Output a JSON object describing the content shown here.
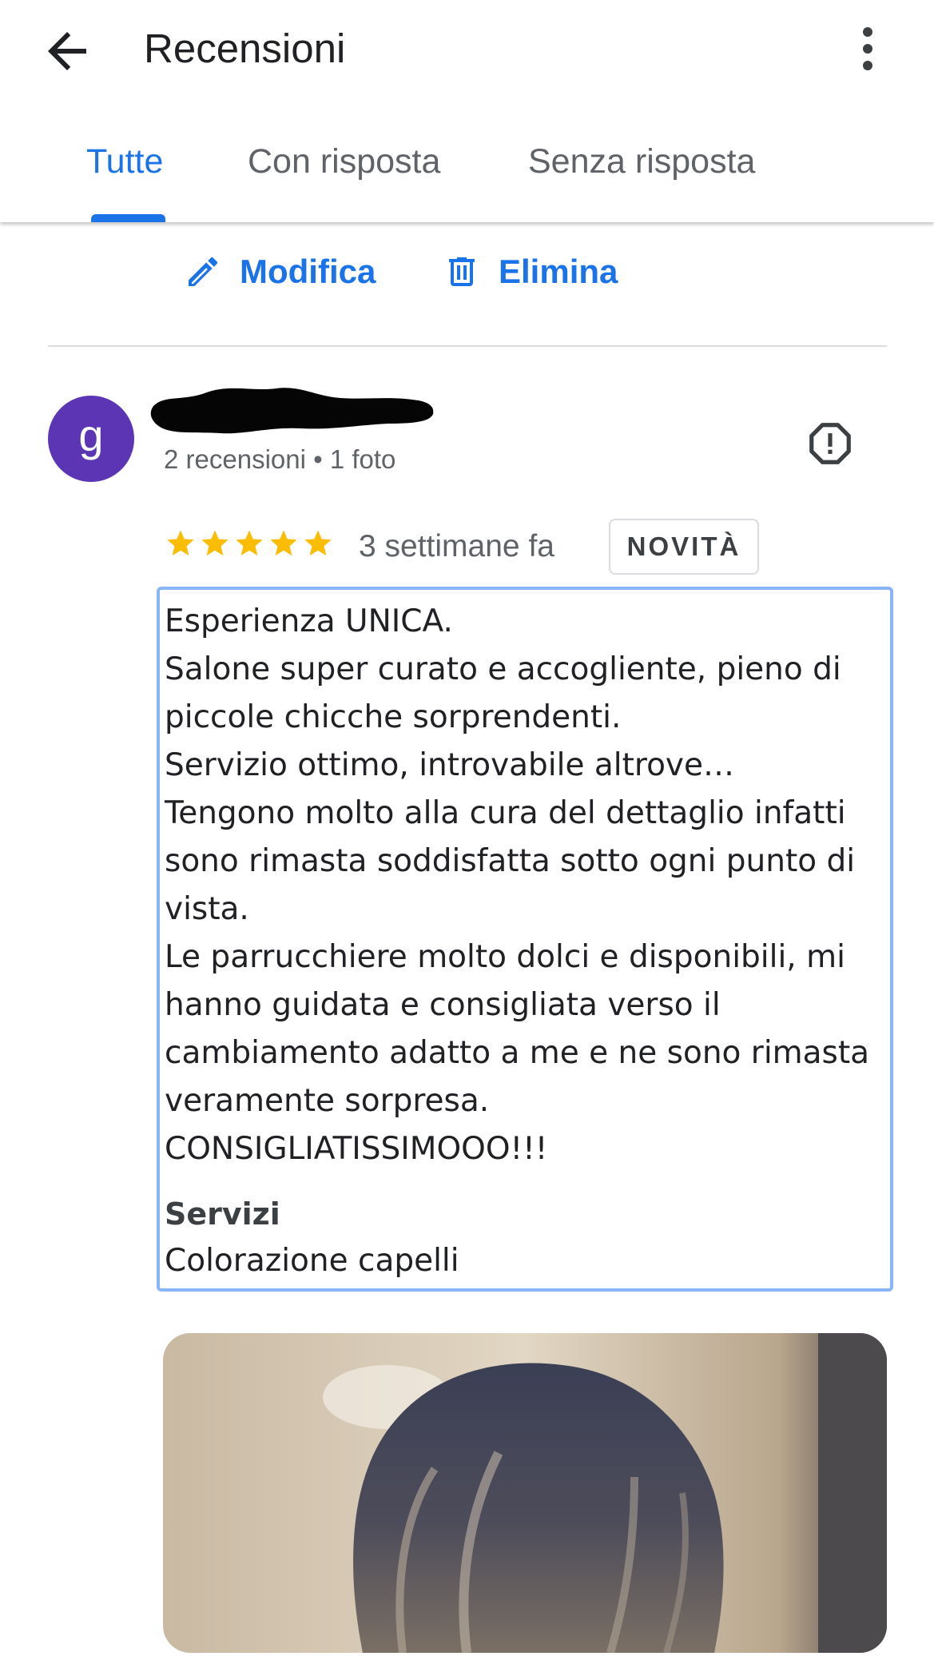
{
  "header": {
    "title": "Recensioni",
    "back_icon": "arrow-back-icon",
    "more_icon": "more-vert-icon"
  },
  "tabs": [
    {
      "label": "Tutte",
      "active": true
    },
    {
      "label": "Con risposta",
      "active": false
    },
    {
      "label": "Senza risposta",
      "active": false
    }
  ],
  "owner_actions": {
    "edit_label": "Modifica",
    "edit_icon": "pencil-icon",
    "delete_label": "Elimina",
    "delete_icon": "trash-icon"
  },
  "review": {
    "avatar_initial": "g",
    "avatar_color": "#5c35b4",
    "reviewer_meta": "2 recensioni • 1 foto",
    "report_icon": "report-icon",
    "rating": 5,
    "max_rating": 5,
    "star_color": "#fbbc04",
    "time": "3 settimane fa",
    "badge": "NOVITÀ",
    "text": "Esperienza UNICA.\nSalone super curato e accogliente, pieno di piccole chicche sorprendenti.\nServizio ottimo, introvabile altrove…\nTengono molto alla cura del dettaglio infatti sono rimasta soddisfatta sotto ogni punto di vista.\nLe parrucchiere molto dolci e disponibili, mi hanno guidata e consigliata verso il cambiamento adatto a me e ne sono rimasta veramente sorpresa.\nCONSIGLIATISSIMOOO!!!",
    "services_label": "Servizi",
    "services_value": "Colorazione capelli"
  },
  "colors": {
    "accent": "#1a73e8",
    "focus_outline": "#8ab4f8",
    "divider": "#dadce0"
  }
}
